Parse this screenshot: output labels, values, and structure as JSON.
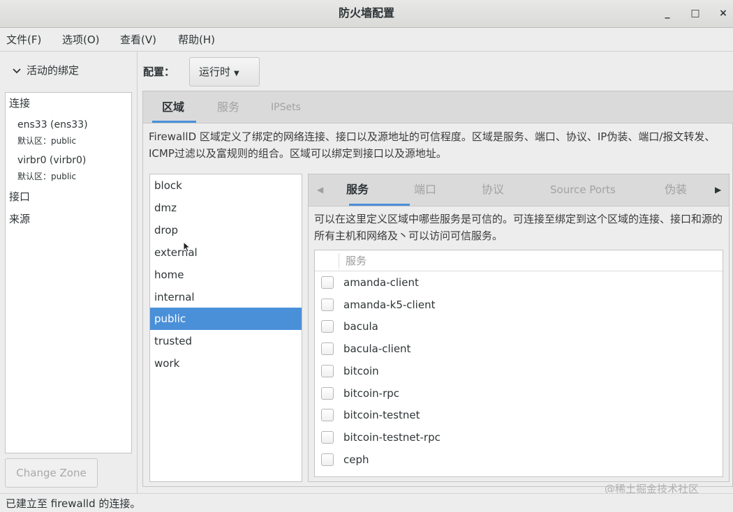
{
  "window": {
    "title": "防火墙配置",
    "controls": {
      "minimize": "_",
      "maximize": "□",
      "close": "×"
    }
  },
  "menu": {
    "items": [
      {
        "label": "文件(F)"
      },
      {
        "label": "选项(O)"
      },
      {
        "label": "查看(V)"
      },
      {
        "label": "帮助(H)"
      }
    ]
  },
  "sidebar": {
    "toggle_label": "活动的绑定",
    "toggle_icon": "chevron-down-icon",
    "connections_heading": "连接",
    "connections": [
      {
        "name": "ens33 (ens33)",
        "zone": "默认区：public"
      },
      {
        "name": "virbr0 (virbr0)",
        "zone": "默认区：public"
      }
    ],
    "interfaces_heading": "接口",
    "sources_heading": "来源",
    "change_zone_label": "Change Zone"
  },
  "config": {
    "label": "配置：",
    "value": "运行时"
  },
  "tabs": [
    {
      "label": "区域",
      "active": true
    },
    {
      "label": "服务",
      "active": false
    },
    {
      "label": "IPSets",
      "active": false
    }
  ],
  "zones_description": "FirewallD 区域定义了绑定的网络连接、接口以及源地址的可信程度。区域是服务、端口、协议、IP伪装、端口/报文转发、ICMP过滤以及富规则的组合。区域可以绑定到接口以及源地址。",
  "zones": {
    "items": [
      "block",
      "dmz",
      "drop",
      "external",
      "home",
      "internal",
      "public",
      "trusted",
      "work"
    ],
    "selected": "public"
  },
  "zone_tabs": [
    {
      "label": "服务",
      "active": true
    },
    {
      "label": "端口",
      "active": false
    },
    {
      "label": "协议",
      "active": false
    },
    {
      "label": "Source Ports",
      "active": false
    },
    {
      "label": "伪装",
      "active": false
    }
  ],
  "services_description": "可以在这里定义区域中哪些服务是可信的。可连接至绑定到这个区域的连接、接口和源的所有主机和网络及丶可以访问可信服务。",
  "services": {
    "column_header": "服务",
    "items": [
      {
        "name": "amanda-client",
        "checked": false
      },
      {
        "name": "amanda-k5-client",
        "checked": false
      },
      {
        "name": "bacula",
        "checked": false
      },
      {
        "name": "bacula-client",
        "checked": false
      },
      {
        "name": "bitcoin",
        "checked": false
      },
      {
        "name": "bitcoin-rpc",
        "checked": false
      },
      {
        "name": "bitcoin-testnet",
        "checked": false
      },
      {
        "name": "bitcoin-testnet-rpc",
        "checked": false
      },
      {
        "name": "ceph",
        "checked": false
      }
    ]
  },
  "status": "已建立至  firewalld 的连接。",
  "watermark": "@稀土掘金技术社区",
  "colors": {
    "accent": "#4a90d9",
    "background": "#ededed",
    "tabbar": "#dadada"
  }
}
